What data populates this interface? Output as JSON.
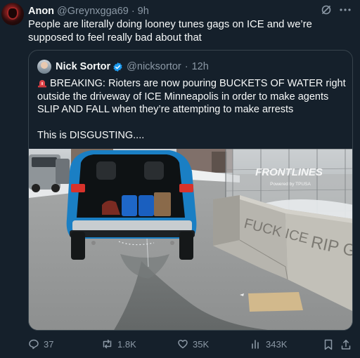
{
  "tweet": {
    "author_name": "Anon",
    "author_handle": "@Greynxgga69",
    "separator": "·",
    "time": "9h",
    "text": "People are literally doing looney tunes gags on ICE and we’re supposed to feel really bad about that"
  },
  "quoted": {
    "author_name": "Nick Sortor",
    "author_handle": "@nicksortor",
    "separator": "·",
    "time": "12h",
    "line1": "BREAKING: Rioters are now pouring BUCKETS OF WATER right outside the driveway of ICE Minneapolis in order to make agents SLIP AND FALL when they’re attempting to make arrests",
    "line2": "This is DISGUSTING....",
    "media": {
      "watermark": "FRONTLINES",
      "watermark_sub": "Powered by TPUSA",
      "barrier_text_1": "FUCK ICE",
      "barrier_text_2": "RIP GOOD"
    }
  },
  "actions": {
    "replies": "37",
    "reposts": "1.8K",
    "likes": "35K",
    "views": "343K"
  },
  "colors": {
    "background": "#15202b",
    "text": "#f7f9f9",
    "muted": "#8b98a5",
    "border": "#38444d",
    "verified": "#1d9bf0"
  }
}
